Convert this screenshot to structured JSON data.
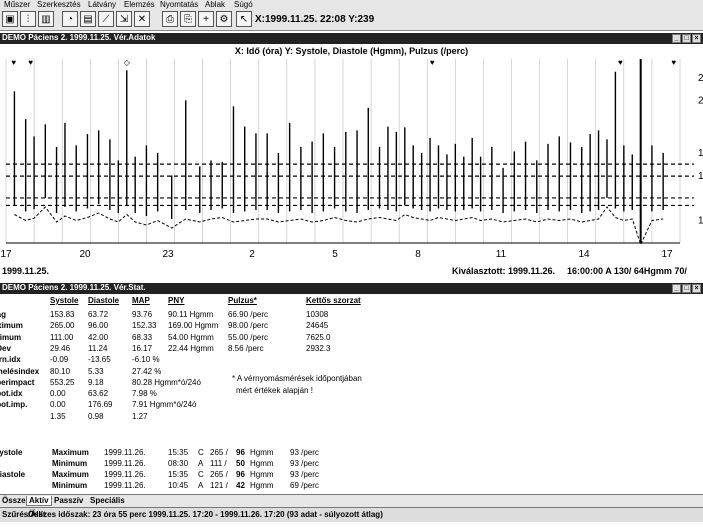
{
  "menu": [
    "Műszer",
    "Szerkesztés",
    "Látvány",
    "Elemzés",
    "Nyomtatás",
    "Ablak",
    "Súgó"
  ],
  "toolbar": {
    "status": "X:1999.11.25. 22:08  Y:239"
  },
  "chart_window": {
    "title": "DEMO Páciens 2. 1999.11.25. Vér.Adatok",
    "header": "X: Idő (óra)  Y: Systole, Diastole (Hgmm), Pulzus (/perc)",
    "x_ticks": [
      "17",
      "20",
      "23",
      "2",
      "5",
      "8",
      "11",
      "14",
      "17"
    ],
    "y_ticks": [
      "2",
      "2",
      "1",
      "1",
      "1"
    ],
    "date_label": "1999.11.25.",
    "selected_label": "Kiválasztott: 1999.11.26.",
    "selected_value": "16:00:00  A 130/  64Hgmm  70/"
  },
  "chart_data": {
    "type": "bar",
    "xlabel": "Idő (óra)",
    "ylabel": "Systole, Diastole (Hgmm), Pulzus (/perc)",
    "x_range": [
      17,
      41
    ],
    "y_range": [
      30,
      275
    ],
    "reference_lines": [
      135,
      119,
      90,
      80
    ],
    "series": [
      {
        "name": "Systole/Diastole",
        "values": [
          [
            17.3,
            232,
            80
          ],
          [
            17.7,
            195,
            72
          ],
          [
            18.0,
            172,
            75
          ],
          [
            18.4,
            188,
            90
          ],
          [
            18.8,
            158,
            70
          ],
          [
            19.1,
            190,
            78
          ],
          [
            19.5,
            160,
            72
          ],
          [
            19.9,
            175,
            76
          ],
          [
            20.3,
            180,
            82
          ],
          [
            20.7,
            168,
            74
          ],
          [
            21.0,
            140,
            70
          ],
          [
            21.3,
            260,
            80
          ],
          [
            21.6,
            145,
            70
          ],
          [
            22.0,
            160,
            66
          ],
          [
            22.4,
            150,
            72
          ],
          [
            22.9,
            120,
            62
          ],
          [
            23.4,
            220,
            74
          ],
          [
            23.9,
            132,
            70
          ],
          [
            24.3,
            140,
            74
          ],
          [
            24.7,
            138,
            76
          ],
          [
            25.1,
            212,
            70
          ],
          [
            25.5,
            185,
            72
          ],
          [
            25.9,
            176,
            74
          ],
          [
            26.3,
            176,
            74
          ],
          [
            26.7,
            150,
            70
          ],
          [
            27.1,
            190,
            72
          ],
          [
            27.5,
            158,
            74
          ],
          [
            27.9,
            165,
            70
          ],
          [
            28.3,
            176,
            72
          ],
          [
            28.7,
            158,
            76
          ],
          [
            29.1,
            178,
            72
          ],
          [
            29.5,
            180,
            70
          ],
          [
            29.9,
            210,
            74
          ],
          [
            30.3,
            158,
            76
          ],
          [
            30.6,
            185,
            74
          ],
          [
            30.9,
            178,
            72
          ],
          [
            31.2,
            184,
            80
          ],
          [
            31.5,
            160,
            76
          ],
          [
            31.8,
            150,
            74
          ],
          [
            32.1,
            170,
            72
          ],
          [
            32.4,
            160,
            76
          ],
          [
            32.7,
            148,
            74
          ],
          [
            33.0,
            162,
            72
          ],
          [
            33.3,
            145,
            74
          ],
          [
            33.6,
            170,
            76
          ],
          [
            33.9,
            145,
            72
          ],
          [
            34.3,
            158,
            74
          ],
          [
            34.7,
            130,
            70
          ],
          [
            35.1,
            152,
            72
          ],
          [
            35.5,
            165,
            74
          ],
          [
            35.9,
            140,
            70
          ],
          [
            36.3,
            162,
            74
          ],
          [
            36.7,
            172,
            72
          ],
          [
            37.1,
            164,
            74
          ],
          [
            37.5,
            158,
            70
          ],
          [
            37.8,
            175,
            72
          ],
          [
            38.1,
            180,
            74
          ],
          [
            38.4,
            168,
            90
          ],
          [
            38.7,
            258,
            76
          ],
          [
            39.0,
            160,
            72
          ],
          [
            39.3,
            148,
            74
          ],
          [
            39.6,
            270,
            40
          ],
          [
            40.0,
            160,
            72
          ],
          [
            40.4,
            150,
            74
          ]
        ]
      }
    ]
  },
  "stats_window": {
    "title": "DEMO Páciens 2. 1999.11.25. Vér.Stat.",
    "headers": [
      "Systole",
      "Diastole",
      "MAP",
      "PNY",
      "Pulzus*",
      "Kettős szorzat"
    ],
    "rows": [
      {
        "label": "Átlag",
        "cols": [
          "153.83",
          "63.72",
          "93.76",
          "90.11 Hgmm",
          "66.90 /perc",
          "10308"
        ]
      },
      {
        "label": "Maximum",
        "cols": [
          "265.00",
          "96.00",
          "152.33",
          "169.00 Hgmm",
          "98.00 /perc",
          "24645"
        ]
      },
      {
        "label": "Minimum",
        "cols": [
          "111.00",
          "42.00",
          "68.33",
          "54.00 Hgmm",
          "55.00 /perc",
          "7625.0"
        ]
      },
      {
        "label": "St.Dev",
        "cols": [
          "29.46",
          "11.24",
          "16.17",
          "22.44 Hgmm",
          "8.56 /perc",
          "2932.3"
        ]
      },
      {
        "label": "Diurn.idx",
        "cols": [
          "-0.09",
          "-13.65",
          "-6.10 %",
          "",
          "",
          ""
        ]
      },
      {
        "label": "Terhelésindex",
        "cols": [
          "80.10",
          "5.33",
          "27.42 %",
          "",
          "",
          ""
        ]
      },
      {
        "label": "Hyperimpact",
        "cols": [
          "553.25",
          "9.18",
          "80.28 Hgmm*ó/24ó",
          "",
          "",
          ""
        ]
      },
      {
        "label": "Hypot.idx",
        "cols": [
          "0.00",
          "63.62",
          "7.98 %",
          "",
          "",
          ""
        ]
      },
      {
        "label": "Hypot.imp.",
        "cols": [
          "0.00",
          "176.69",
          "7.91 Hgmm*ó/24ó",
          "",
          "",
          ""
        ]
      },
      {
        "label": "CV",
        "cols": [
          "1.35",
          "0.98",
          "1.27",
          "",
          "",
          ""
        ]
      }
    ],
    "note_line1": "* A vérnyomásmérések időpontjában",
    "note_line2": "mért értékek alapján !",
    "extremes": [
      {
        "group": "Systole",
        "kind": "Maximum",
        "date": "1999.11.26.",
        "time": "15:35",
        "mode": "C",
        "sys": "265 /",
        "dia": "96",
        "unit": "Hgmm",
        "pulse": "93 /perc"
      },
      {
        "group": "",
        "kind": "Minimum",
        "date": "1999.11.26.",
        "time": "08:30",
        "mode": "A",
        "sys": "111 /",
        "dia": "50",
        "unit": "Hgmm",
        "pulse": "93 /perc"
      },
      {
        "group": "Diastole",
        "kind": "Maximum",
        "date": "1999.11.26.",
        "time": "15:35",
        "mode": "C",
        "sys": "265 /",
        "dia": "96",
        "unit": "Hgmm",
        "pulse": "93 /perc"
      },
      {
        "group": "",
        "kind": "Minimum",
        "date": "1999.11.26.",
        "time": "10:45",
        "mode": "A",
        "sys": "121 /",
        "dia": "42",
        "unit": "Hgmm",
        "pulse": "69 /perc"
      }
    ]
  },
  "tabs": [
    "Összes",
    "Aktív",
    "Passzív",
    "Speciális"
  ],
  "status_bar": {
    "left": "Szűrés/Állít",
    "text": "Összes időszak: 23 óra 55 perc   1999.11.25. 17:20 - 1999.11.26. 17:20   (93 adat - súlyozott átlag)"
  }
}
